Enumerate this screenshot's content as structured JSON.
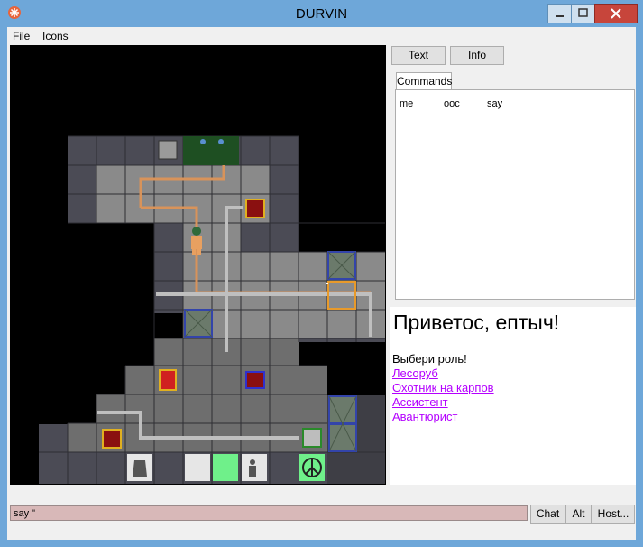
{
  "window": {
    "title": "DURVIN"
  },
  "menu": {
    "items": [
      "File",
      "Icons"
    ]
  },
  "right_panel": {
    "buttons": {
      "text": "Text",
      "info": "Info"
    },
    "tab": "Commands",
    "commands": [
      "me",
      "ooc",
      "say"
    ]
  },
  "output": {
    "greeting": "Приветос, ептыч!",
    "prompt": "Выбери роль!",
    "roles": [
      "Лесоруб",
      "Охотник на карпов",
      "Ассистент",
      "Авантюрист"
    ]
  },
  "input": {
    "value": "say \""
  },
  "bottom_buttons": {
    "chat": "Chat",
    "alt": "Alt",
    "host": "Host..."
  },
  "colors": {
    "role_link": "#b400ff",
    "input_bg": "#d8b8b8",
    "title_bar": "#6ea7d9",
    "close_button": "#c7453b"
  }
}
